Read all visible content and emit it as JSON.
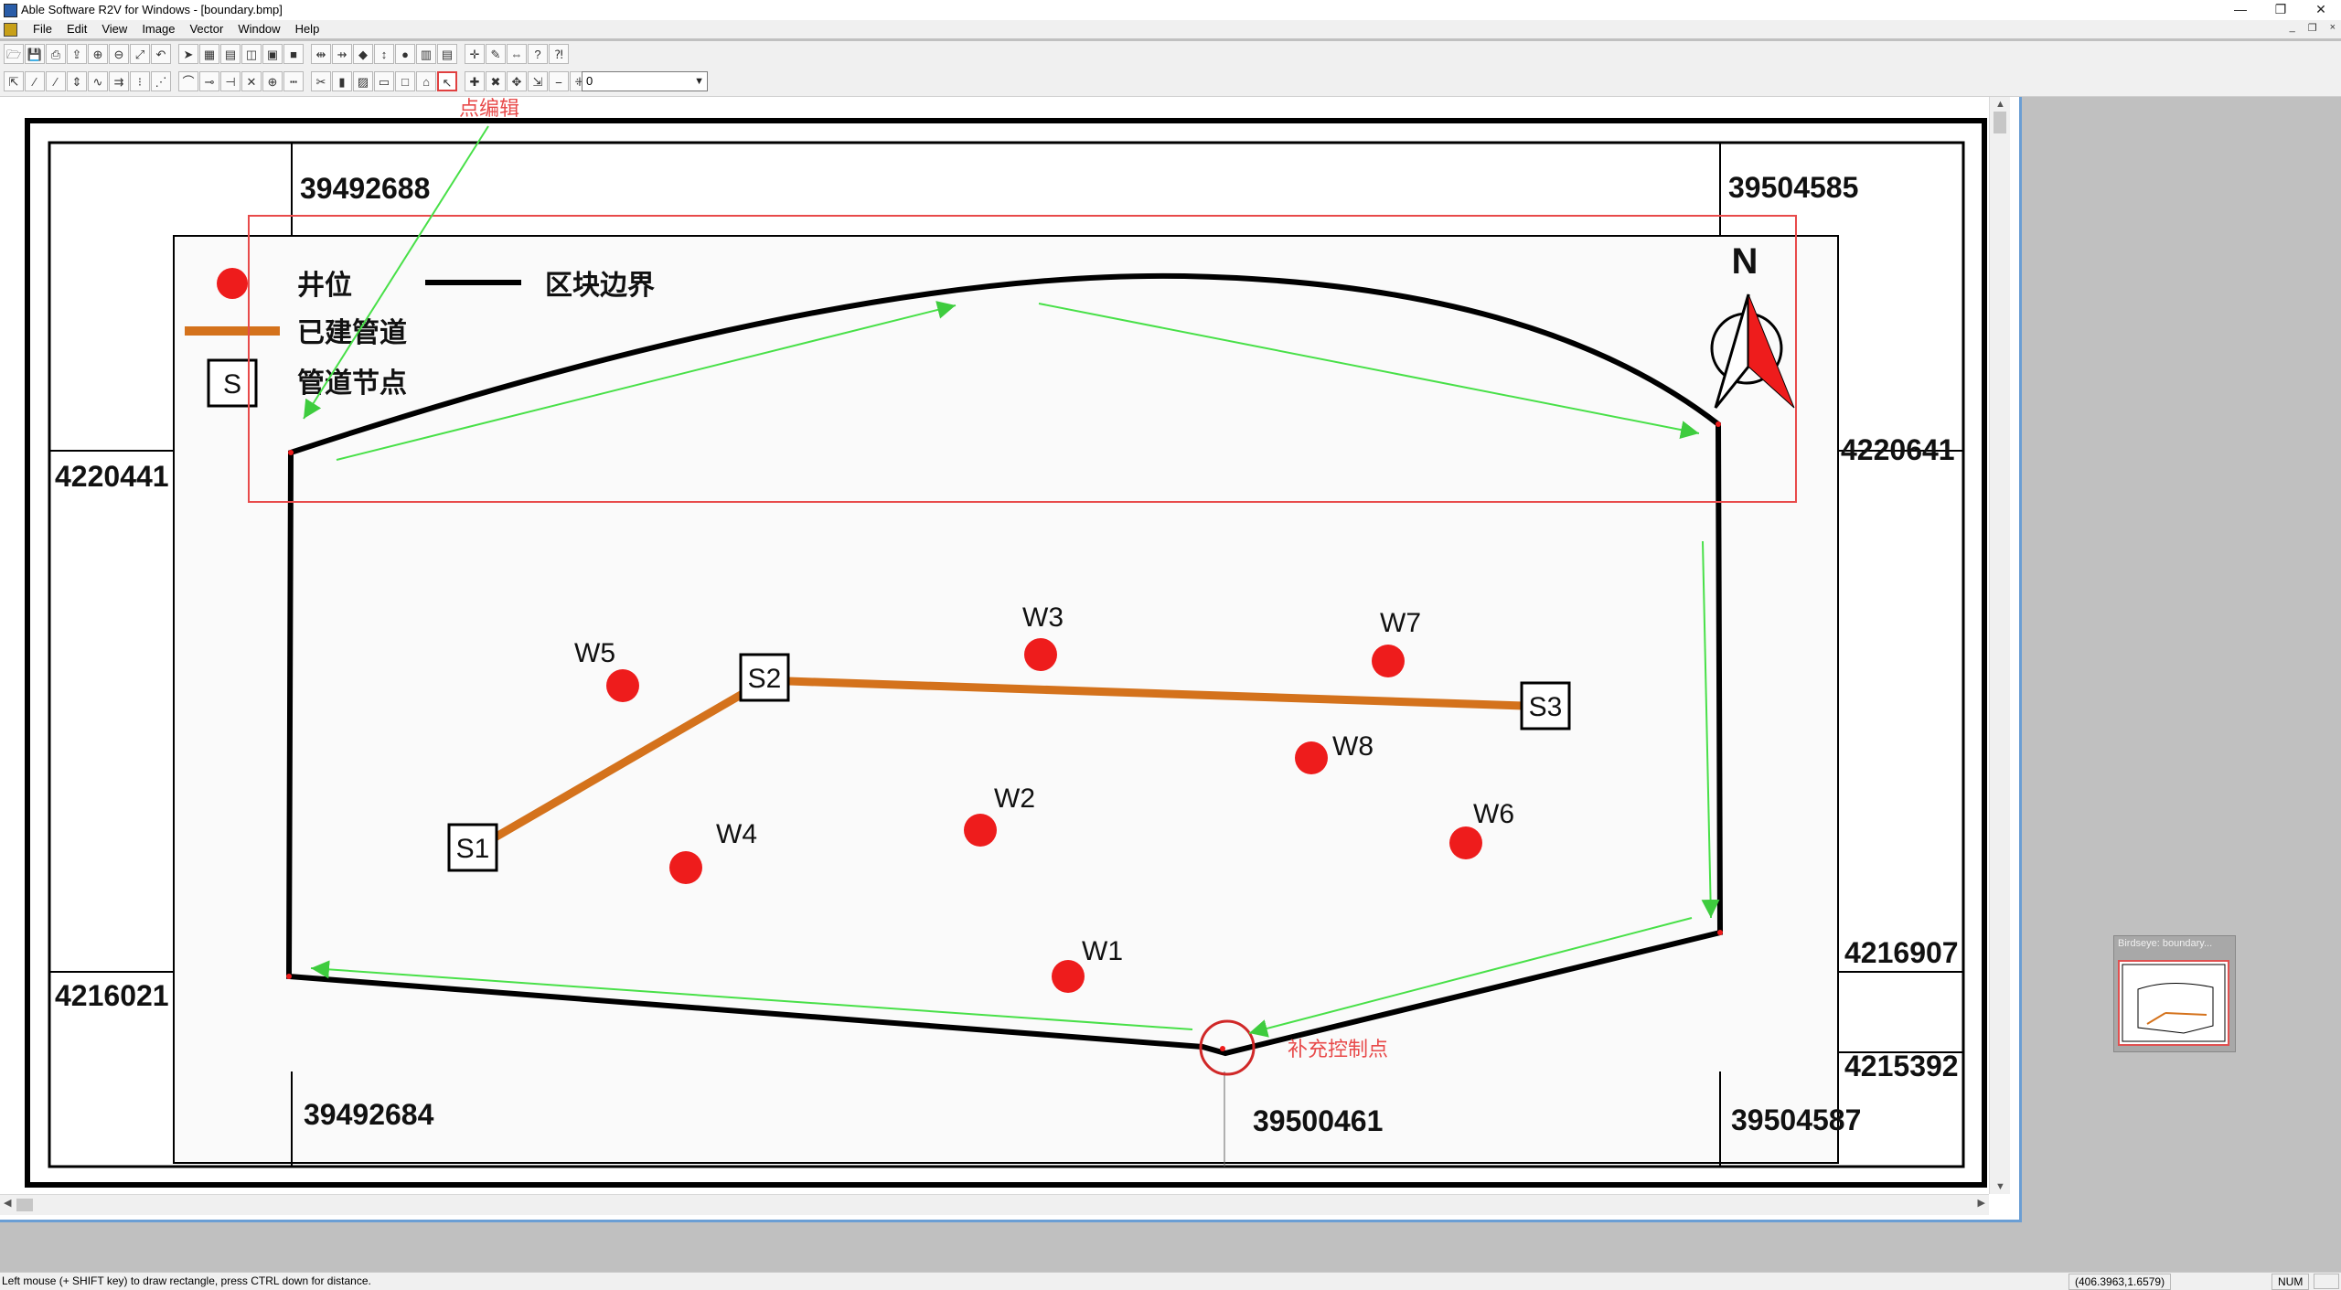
{
  "window": {
    "title": "Able Software R2V for Windows - [boundary.bmp]",
    "min": "—",
    "restore": "❐",
    "close": "✕"
  },
  "menu": [
    "File",
    "Edit",
    "View",
    "Image",
    "Vector",
    "Window",
    "Help"
  ],
  "mdi_controls": {
    "min": "_",
    "restore": "❐",
    "close": "×"
  },
  "toolbar": {
    "row1_icons": [
      "open-icon",
      "save-icon",
      "print-icon",
      "export-icon",
      "zoom-in-icon",
      "zoom-out-icon",
      "zoom-fit-icon",
      "undo-icon",
      "pointer-icon",
      "grid-icon",
      "layers-icon",
      "map-icon",
      "raster-icon",
      "fill-icon",
      "split-icon",
      "merge-icon",
      "node-icon",
      "move-node-icon",
      "delete-node-icon",
      "table-icon",
      "list-icon",
      "crosshair-icon",
      "pick-icon",
      "measure-icon",
      "help-icon",
      "context-help-icon"
    ],
    "row2_icons": [
      "select-icon",
      "line-icon",
      "line2-icon",
      "vert-icon",
      "spline-icon",
      "offset-icon",
      "trace-icon",
      "auto-icon",
      "curve-icon",
      "join-icon",
      "break-icon",
      "close-icon",
      "snap-icon",
      "dash-icon",
      "cut-icon",
      "bar-icon",
      "hatch-icon",
      "frame-icon",
      "box-icon",
      "label-icon",
      "vertex-edit-icon",
      "add-vertex-icon",
      "del-vertex-icon",
      "move-vertex-icon",
      "insert-vertex-icon",
      "straighten-icon",
      "marker-icon"
    ],
    "value_select": "0"
  },
  "map": {
    "annotations": {
      "point_edit": "点编辑",
      "add_control_point": "补充控制点"
    },
    "coords": {
      "top_left": "39492688",
      "top_right": "39504585",
      "left_top": "4220441",
      "right_top": "4220641",
      "right_bottom": "4216907",
      "left_bottom": "4216021",
      "right_lowest": "4215392",
      "bottom_left": "39492684",
      "bottom_mid": "39500461",
      "bottom_right": "39504587"
    },
    "legend": {
      "well": "井位",
      "boundary": "区块边界",
      "pipeline": "已建管道",
      "node": "管道节点",
      "node_symbol": "S"
    },
    "north": "N",
    "wells": [
      "W1",
      "W2",
      "W3",
      "W4",
      "W5",
      "W6",
      "W7",
      "W8"
    ],
    "nodes": [
      "S1",
      "S2",
      "S3"
    ],
    "colors": {
      "well": "#ee1c1c",
      "pipeline": "#d4721c",
      "arrow": "#48e048",
      "highlight": "#e84a4a"
    }
  },
  "birdseye": {
    "title": "Birdseye: boundary..."
  },
  "status": {
    "hint": "Left mouse (+ SHIFT key) to draw rectangle, press CTRL down for distance.",
    "coords": "(406.3963,1.6579)",
    "num": "NUM"
  }
}
